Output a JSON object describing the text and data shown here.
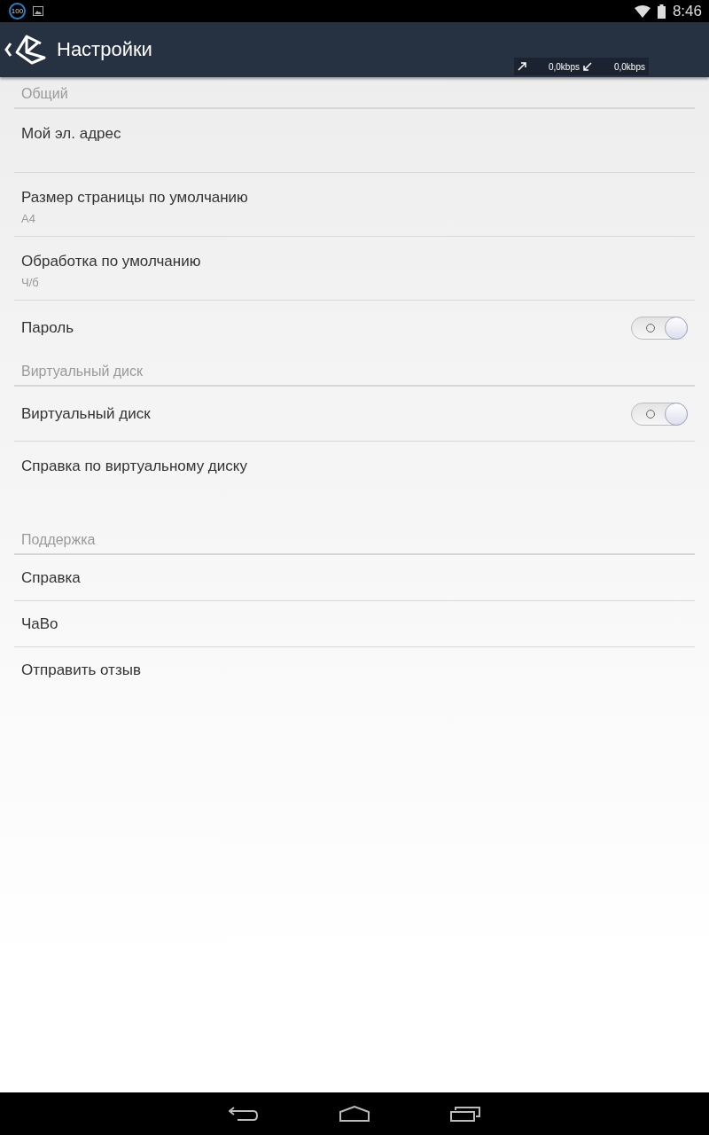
{
  "status_bar": {
    "badge": "100",
    "time": "8:46"
  },
  "action_bar": {
    "title": "Настройки",
    "upload": "0,0kbps",
    "download": "0,0kbps"
  },
  "sections": [
    {
      "header": "Общий",
      "rows": [
        {
          "kind": "entry",
          "title": "Мой эл. адрес"
        },
        {
          "kind": "entry",
          "title": "Размер страницы по умолчанию",
          "summary": "A4"
        },
        {
          "kind": "entry",
          "title": "Обработка по умолчанию",
          "summary": "Ч/б"
        },
        {
          "kind": "toggle",
          "title": "Пароль",
          "on": false
        }
      ]
    },
    {
      "header": "Виртуальный диск",
      "rows": [
        {
          "kind": "toggle",
          "title": "Виртуальный диск",
          "on": false
        },
        {
          "kind": "entry",
          "title": "Справка по виртуальному диску"
        }
      ]
    },
    {
      "header": "Поддержка",
      "rows": [
        {
          "kind": "link",
          "title": "Справка"
        },
        {
          "kind": "link",
          "title": "ЧаВо"
        },
        {
          "kind": "link",
          "title": "Отправить отзыв"
        }
      ]
    }
  ]
}
